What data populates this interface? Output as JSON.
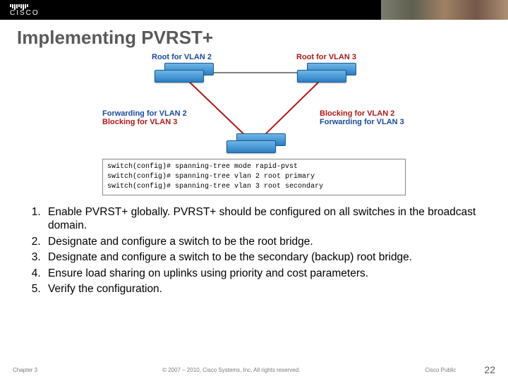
{
  "brand": "CISCO",
  "title": "Implementing PVRST+",
  "diagram": {
    "label_top_left": "Root for VLAN 2",
    "label_top_right": "Root for VLAN 3",
    "label_left_a": "Forwarding for VLAN 2",
    "label_left_b": "Blocking for VLAN 3",
    "label_right_a": "Blocking for VLAN 2",
    "label_right_b": "Forwarding for VLAN 3",
    "cli_prompt": "switch(config)#",
    "cli_line1": "spanning-tree mode rapid-pvst",
    "cli_line2": "spanning-tree vlan 2 root primary",
    "cli_line3": "spanning-tree vlan 3 root secondary"
  },
  "steps": [
    "Enable PVRST+ globally. PVRST+ should be configured on all switches in the broadcast domain.",
    "Designate and configure a switch to be the root bridge.",
    "Designate and configure a switch to be the secondary (backup) root bridge.",
    "Ensure load sharing on uplinks using priority and cost parameters.",
    "Verify the configuration."
  ],
  "footer": {
    "chapter": "Chapter 3",
    "copyright": "© 2007 – 2010, Cisco Systems, Inc. All rights reserved.",
    "classification": "Cisco Public",
    "page": "22"
  }
}
